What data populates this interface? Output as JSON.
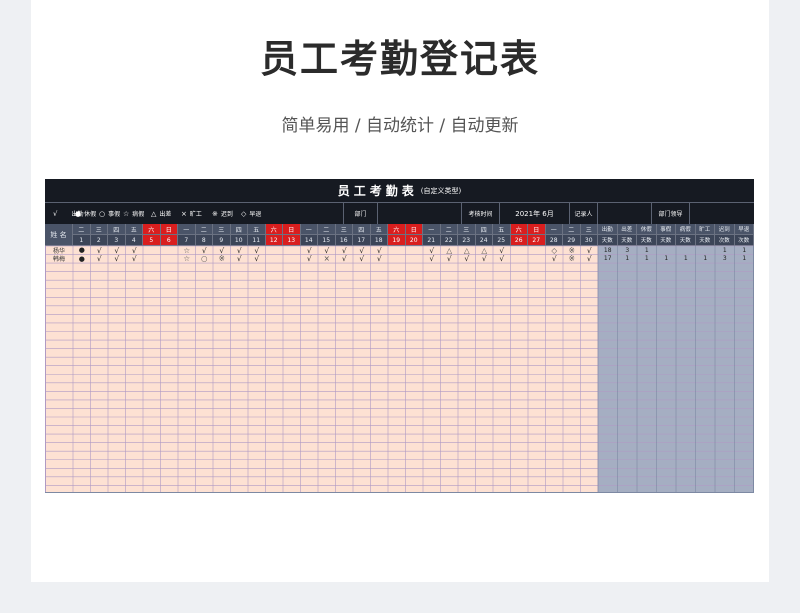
{
  "page": {
    "title": "员工考勤登记表",
    "subtitle": "简单易用 / 自动统计 / 自动更新"
  },
  "sheet": {
    "title": "员工考勤表",
    "title_suffix": "(自定义类型)",
    "legend": [
      {
        "symbol": "√",
        "label": "出勤"
      },
      {
        "symbol": "●",
        "label": "休假"
      },
      {
        "symbol": "○",
        "label": "事假"
      },
      {
        "symbol": "☆",
        "label": "病假"
      },
      {
        "symbol": "△",
        "label": "出差"
      },
      {
        "symbol": "×",
        "label": "旷工"
      },
      {
        "symbol": "※",
        "label": "迟到"
      },
      {
        "symbol": "◇",
        "label": "早退"
      }
    ],
    "info": {
      "dept_label": "部门",
      "dept_value": "",
      "period_label": "考核时间",
      "period_value": "2021年 6月",
      "recorder_label": "记录人",
      "recorder_value": "",
      "leader_label": "部门领导",
      "leader_value": ""
    },
    "name_header": "姓 名",
    "weekday_headers": [
      "二",
      "三",
      "四",
      "五",
      "六",
      "日",
      "一",
      "二",
      "三",
      "四",
      "五",
      "六",
      "日",
      "一",
      "二",
      "三",
      "四",
      "五",
      "六",
      "日",
      "一",
      "二",
      "三",
      "四",
      "五",
      "六",
      "日",
      "一",
      "二",
      "三"
    ],
    "day_numbers": [
      "1",
      "2",
      "3",
      "4",
      "5",
      "6",
      "7",
      "8",
      "9",
      "10",
      "11",
      "12",
      "13",
      "14",
      "15",
      "16",
      "17",
      "18",
      "19",
      "20",
      "21",
      "22",
      "23",
      "24",
      "25",
      "26",
      "27",
      "28",
      "29",
      "30"
    ],
    "summary_headers_top": [
      "出勤",
      "出差",
      "休假",
      "事假",
      "病假",
      "旷工",
      "迟到",
      "早退"
    ],
    "summary_headers_bottom": [
      "天数",
      "天数",
      "天数",
      "天数",
      "天数",
      "天数",
      "次数",
      "次数"
    ],
    "employees": [
      {
        "name": "杨华",
        "days": [
          "●",
          "√",
          "√",
          "√",
          "",
          "",
          "☆",
          "√",
          "√",
          "√",
          "√",
          "",
          "",
          "√",
          "√",
          "√",
          "√",
          "√",
          "",
          "",
          "√",
          "△",
          "△",
          "△",
          "√",
          "",
          "",
          "◇",
          "※",
          "√"
        ],
        "summary": [
          "18",
          "3",
          "1",
          "",
          "",
          "",
          "1",
          "1"
        ]
      },
      {
        "name": "韩梅",
        "days": [
          "●",
          "√",
          "√",
          "√",
          "",
          "",
          "☆",
          "○",
          "※",
          "√",
          "√",
          "",
          "",
          "√",
          "×",
          "√",
          "√",
          "√",
          "",
          "",
          "√",
          "√",
          "√",
          "√",
          "√",
          "",
          "",
          "√",
          "※",
          "√"
        ],
        "summary": [
          "17",
          "1",
          "1",
          "1",
          "1",
          "1",
          "3",
          "1"
        ]
      }
    ],
    "colors": {
      "dark": "#161a22",
      "weekday_header": "#4a5468",
      "weekend_header": "#d91e1e",
      "body_fill": "#fde1d3",
      "summary_fill": "#a5aec2",
      "grid_line": "#b09ac4"
    }
  }
}
